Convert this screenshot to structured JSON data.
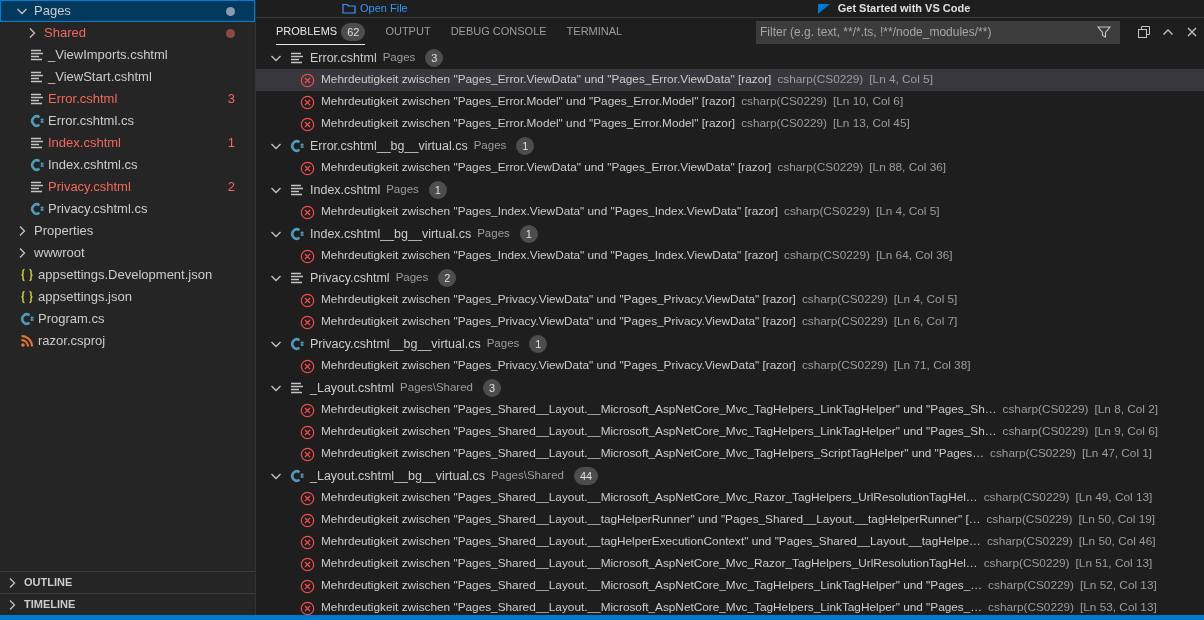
{
  "editor": {
    "open_file_link": "Open File",
    "walkthrough_title": "Get Started with VS Code"
  },
  "explorer": {
    "items": [
      {
        "label": "Pages",
        "kind": "folder",
        "expanded": true,
        "selected": true,
        "has_errors": false,
        "dot": true,
        "children": [
          {
            "label": "Shared",
            "kind": "folder",
            "expanded": false,
            "selected": false,
            "has_errors": true,
            "dot": true
          },
          {
            "label": "_ViewImports.cshtml",
            "kind": "razor",
            "selected": false,
            "has_errors": false
          },
          {
            "label": "_ViewStart.cshtml",
            "kind": "razor",
            "selected": false,
            "has_errors": false
          },
          {
            "label": "Error.cshtml",
            "kind": "razor",
            "selected": false,
            "has_errors": true,
            "count": "3"
          },
          {
            "label": "Error.cshtml.cs",
            "kind": "csharp",
            "selected": false,
            "has_errors": false
          },
          {
            "label": "Index.cshtml",
            "kind": "razor",
            "selected": false,
            "has_errors": true,
            "count": "1"
          },
          {
            "label": "Index.cshtml.cs",
            "kind": "csharp",
            "selected": false,
            "has_errors": false
          },
          {
            "label": "Privacy.cshtml",
            "kind": "razor",
            "selected": false,
            "has_errors": true,
            "count": "2"
          },
          {
            "label": "Privacy.cshtml.cs",
            "kind": "csharp",
            "selected": false,
            "has_errors": false
          }
        ]
      },
      {
        "label": "Properties",
        "kind": "folder",
        "expanded": false,
        "selected": false,
        "has_errors": false
      },
      {
        "label": "wwwroot",
        "kind": "folder",
        "expanded": false,
        "selected": false,
        "has_errors": false
      },
      {
        "label": "appsettings.Development.json",
        "kind": "json",
        "selected": false,
        "has_errors": false
      },
      {
        "label": "appsettings.json",
        "kind": "json",
        "selected": false,
        "has_errors": false
      },
      {
        "label": "Program.cs",
        "kind": "csharp",
        "selected": false,
        "has_errors": false
      },
      {
        "label": "razor.csproj",
        "kind": "rss",
        "selected": false,
        "has_errors": false
      }
    ]
  },
  "sections": [
    {
      "label": "OUTLINE",
      "expanded": false
    },
    {
      "label": "TIMELINE",
      "expanded": false
    }
  ],
  "panel": {
    "tabs": [
      {
        "label": "PROBLEMS",
        "count": "62",
        "selected": true
      },
      {
        "label": "OUTPUT",
        "selected": false
      },
      {
        "label": "DEBUG CONSOLE",
        "selected": false
      },
      {
        "label": "TERMINAL",
        "selected": false
      }
    ],
    "filter": {
      "placeholder": "Filter (e.g. text, **/*.ts, !**/node_modules/**)"
    },
    "groups": [
      {
        "file": "Error.cshtml",
        "kind": "razor",
        "path": "Pages",
        "count": "3",
        "expanded": true,
        "problems": [
          {
            "message": "Mehrdeutigkeit zwischen \"Pages_Error.ViewData\" und \"Pages_Error.ViewData\" [razor]",
            "source": "csharp(CS0229)",
            "location": "[Ln 4, Col 5]",
            "selected": true
          },
          {
            "message": "Mehrdeutigkeit zwischen \"Pages_Error.Model\" und \"Pages_Error.Model\" [razor]",
            "source": "csharp(CS0229)",
            "location": "[Ln 10, Col 6]",
            "selected": false
          },
          {
            "message": "Mehrdeutigkeit zwischen \"Pages_Error.Model\" und \"Pages_Error.Model\" [razor]",
            "source": "csharp(CS0229)",
            "location": "[Ln 13, Col 45]",
            "selected": false
          }
        ]
      },
      {
        "file": "Error.cshtml__bg__virtual.cs",
        "kind": "csharp",
        "path": "Pages",
        "count": "1",
        "expanded": true,
        "problems": [
          {
            "message": "Mehrdeutigkeit zwischen \"Pages_Error.ViewData\" und \"Pages_Error.ViewData\" [razor]",
            "source": "csharp(CS0229)",
            "location": "[Ln 88, Col 36]",
            "selected": false
          }
        ]
      },
      {
        "file": "Index.cshtml",
        "kind": "razor",
        "path": "Pages",
        "count": "1",
        "expanded": true,
        "problems": [
          {
            "message": "Mehrdeutigkeit zwischen \"Pages_Index.ViewData\" und \"Pages_Index.ViewData\" [razor]",
            "source": "csharp(CS0229)",
            "location": "[Ln 4, Col 5]",
            "selected": false
          }
        ]
      },
      {
        "file": "Index.cshtml__bg__virtual.cs",
        "kind": "csharp",
        "path": "Pages",
        "count": "1",
        "expanded": true,
        "problems": [
          {
            "message": "Mehrdeutigkeit zwischen \"Pages_Index.ViewData\" und \"Pages_Index.ViewData\" [razor]",
            "source": "csharp(CS0229)",
            "location": "[Ln 64, Col 36]",
            "selected": false
          }
        ]
      },
      {
        "file": "Privacy.cshtml",
        "kind": "razor",
        "path": "Pages",
        "count": "2",
        "expanded": true,
        "problems": [
          {
            "message": "Mehrdeutigkeit zwischen \"Pages_Privacy.ViewData\" und \"Pages_Privacy.ViewData\" [razor]",
            "source": "csharp(CS0229)",
            "location": "[Ln 4, Col 5]",
            "selected": false
          },
          {
            "message": "Mehrdeutigkeit zwischen \"Pages_Privacy.ViewData\" und \"Pages_Privacy.ViewData\" [razor]",
            "source": "csharp(CS0229)",
            "location": "[Ln 6, Col 7]",
            "selected": false
          }
        ]
      },
      {
        "file": "Privacy.cshtml__bg__virtual.cs",
        "kind": "csharp",
        "path": "Pages",
        "count": "1",
        "expanded": true,
        "problems": [
          {
            "message": "Mehrdeutigkeit zwischen \"Pages_Privacy.ViewData\" und \"Pages_Privacy.ViewData\" [razor]",
            "source": "csharp(CS0229)",
            "location": "[Ln 71, Col 38]",
            "selected": false
          }
        ]
      },
      {
        "file": "_Layout.cshtml",
        "kind": "razor",
        "path": "Pages\\Shared",
        "count": "3",
        "expanded": true,
        "problems": [
          {
            "message": "Mehrdeutigkeit zwischen \"Pages_Shared__Layout.__Microsoft_AspNetCore_Mvc_TagHelpers_LinkTagHelper\" und \"Pages_Sh…",
            "source": "csharp(CS0229)",
            "location": "[Ln 8, Col 2]",
            "selected": false
          },
          {
            "message": "Mehrdeutigkeit zwischen \"Pages_Shared__Layout.__Microsoft_AspNetCore_Mvc_TagHelpers_LinkTagHelper\" und \"Pages_Sh…",
            "source": "csharp(CS0229)",
            "location": "[Ln 9, Col 6]",
            "selected": false
          },
          {
            "message": "Mehrdeutigkeit zwischen \"Pages_Shared__Layout.__Microsoft_AspNetCore_Mvc_TagHelpers_ScriptTagHelper\" und \"Pages…",
            "source": "csharp(CS0229)",
            "location": "[Ln 47, Col 1]",
            "selected": false
          }
        ]
      },
      {
        "file": "_Layout.cshtml__bg__virtual.cs",
        "kind": "csharp",
        "path": "Pages\\Shared",
        "count": "44",
        "expanded": true,
        "problems": [
          {
            "message": "Mehrdeutigkeit zwischen \"Pages_Shared__Layout.__Microsoft_AspNetCore_Mvc_Razor_TagHelpers_UrlResolutionTagHel…",
            "source": "csharp(CS0229)",
            "location": "[Ln 49, Col 13]",
            "selected": false
          },
          {
            "message": "Mehrdeutigkeit zwischen \"Pages_Shared__Layout.__tagHelperRunner\" und \"Pages_Shared__Layout.__tagHelperRunner\" […",
            "source": "csharp(CS0229)",
            "location": "[Ln 50, Col 19]",
            "selected": false
          },
          {
            "message": "Mehrdeutigkeit zwischen \"Pages_Shared__Layout.__tagHelperExecutionContext\" und \"Pages_Shared__Layout.__tagHelpe…",
            "source": "csharp(CS0229)",
            "location": "[Ln 50, Col 46]",
            "selected": false
          },
          {
            "message": "Mehrdeutigkeit zwischen \"Pages_Shared__Layout.__Microsoft_AspNetCore_Mvc_Razor_TagHelpers_UrlResolutionTagHel…",
            "source": "csharp(CS0229)",
            "location": "[Ln 51, Col 13]",
            "selected": false
          },
          {
            "message": "Mehrdeutigkeit zwischen \"Pages_Shared__Layout.__Microsoft_AspNetCore_Mvc_TagHelpers_LinkTagHelper\" und \"Pages_…",
            "source": "csharp(CS0229)",
            "location": "[Ln 52, Col 13]",
            "selected": false
          },
          {
            "message": "Mehrdeutigkeit zwischen \"Pages_Shared__Layout.__Microsoft_AspNetCore_Mvc_TagHelpers_LinkTagHelper\" und \"Pages_…",
            "source": "csharp(CS0229)",
            "location": "[Ln 53, Col 13]",
            "selected": false
          }
        ]
      }
    ]
  }
}
